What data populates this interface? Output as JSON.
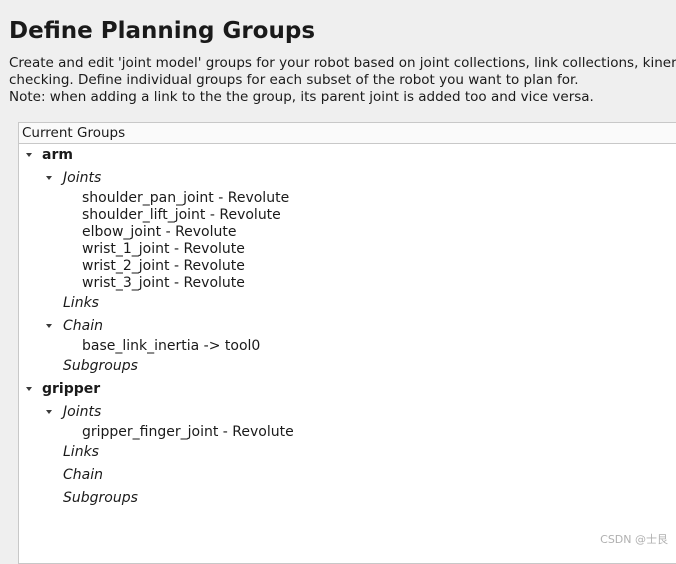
{
  "page": {
    "title": "Define Planning Groups",
    "description": [
      "Create and edit 'joint model' groups for your robot based on joint collections, link collections, kiner",
      "checking. Define individual groups for each subset of the robot you want to plan for.",
      "Note: when adding a link to the the group, its parent joint is added too and vice versa."
    ]
  },
  "tree": {
    "header": "Current Groups",
    "groups": [
      {
        "name": "arm",
        "joints_label": "Joints",
        "joints": [
          "shoulder_pan_joint - Revolute",
          "shoulder_lift_joint - Revolute",
          "elbow_joint - Revolute",
          "wrist_1_joint - Revolute",
          "wrist_2_joint - Revolute",
          "wrist_3_joint - Revolute"
        ],
        "links_label": "Links",
        "chain_label": "Chain",
        "chain": "base_link_inertia  ->  tool0",
        "subgroups_label": "Subgroups"
      },
      {
        "name": "gripper",
        "joints_label": "Joints",
        "joints": [
          "gripper_finger_joint - Revolute"
        ],
        "links_label": "Links",
        "chain_label": "Chain",
        "subgroups_label": "Subgroups"
      }
    ]
  },
  "watermark": "CSDN @士艮"
}
